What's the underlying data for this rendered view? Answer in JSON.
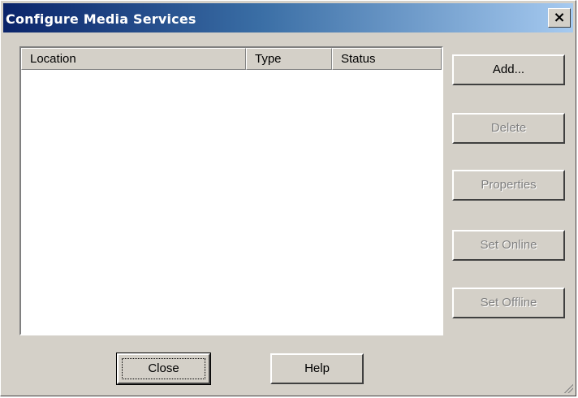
{
  "window": {
    "title": "Configure Media Services",
    "close_glyph": "×"
  },
  "list": {
    "columns": [
      "Location",
      "Type",
      "Status"
    ],
    "rows": []
  },
  "side_buttons": {
    "add": "Add...",
    "delete": "Delete",
    "properties": "Properties",
    "set_online": "Set Online",
    "set_offline": "Set Offline"
  },
  "bottom_buttons": {
    "close": "Close",
    "help": "Help"
  },
  "colors": {
    "titlebar_start": "#0a246a",
    "titlebar_end": "#a6caf0",
    "face": "#d4d0c8",
    "disabled_text": "#808080"
  }
}
